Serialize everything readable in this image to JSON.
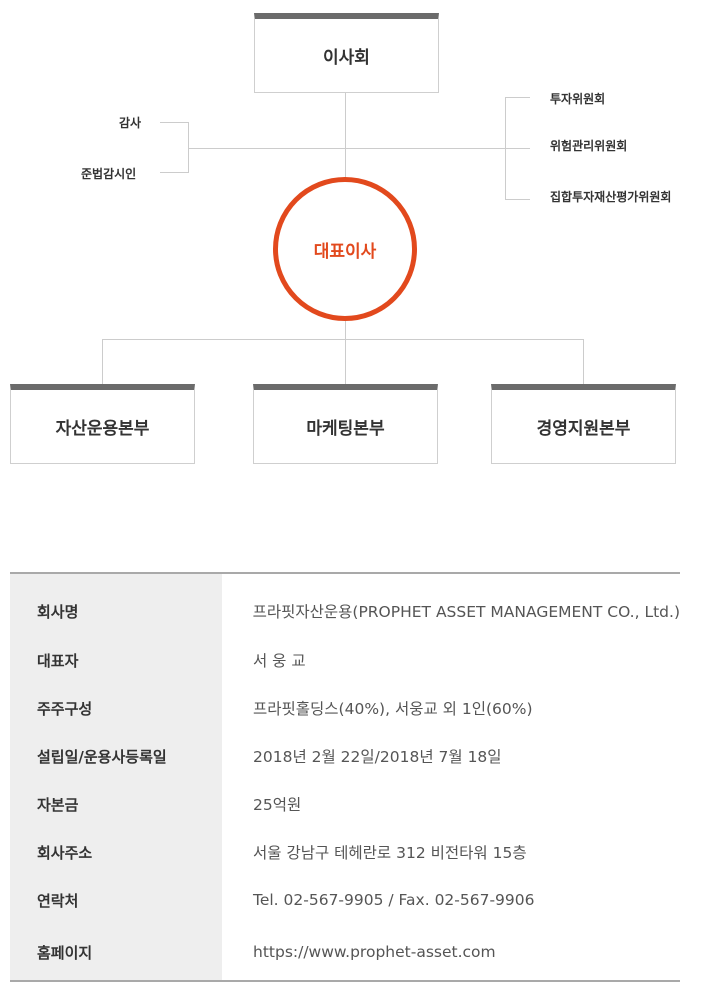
{
  "org": {
    "board": "이사회",
    "audit": "감사",
    "compliance": "준법감시인",
    "committees": [
      "투자위원회",
      "위험관리위원회",
      "집합투자재산평가위원회"
    ],
    "ceo": "대표이사",
    "divisions": [
      "자산운용본부",
      "마케팅본부",
      "경영지원본부"
    ]
  },
  "company_info": [
    {
      "label": "회사명",
      "value": "프라핏자산운용(PROPHET ASSET MANAGEMENT CO., Ltd.)"
    },
    {
      "label": "대표자",
      "value": "서 웅 교"
    },
    {
      "label": "주주구성",
      "value": "프라핏홀딩스(40%), 서웅교 외 1인(60%)"
    },
    {
      "label": "설립일/운용사등록일",
      "value": "2018년 2월 22일/2018년 7월 18일"
    },
    {
      "label": "자본금",
      "value": "25억원"
    },
    {
      "label": "회사주소",
      "value": "서울 강남구 테헤란로 312 비전타워 15층"
    },
    {
      "label": "연락처",
      "value": "Tel. 02-567-9905 / Fax. 02-567-9906"
    },
    {
      "label": "홈페이지",
      "value": "https://www.prophet-asset.com"
    }
  ],
  "colors": {
    "accent": "#e2491d",
    "box_top": "#6b6b6b",
    "line": "#cccccc",
    "label_bg": "#eeeeee"
  }
}
